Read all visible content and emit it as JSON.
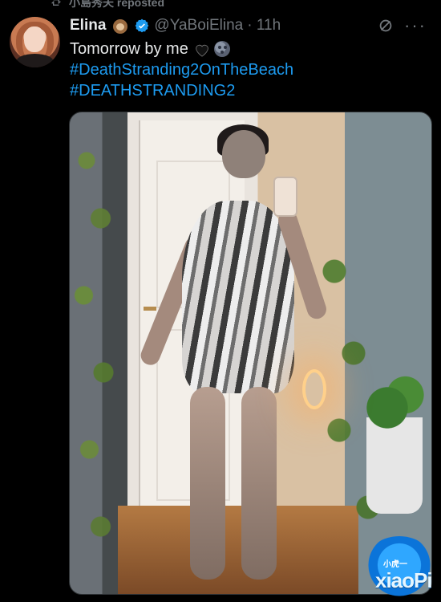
{
  "repost_bar": {
    "text": "小島秀夫 reposted"
  },
  "tweet": {
    "author_name": "Elina",
    "handle": "@YaBoiElina",
    "time": "· 11h",
    "text_line1": "Tomorrow by me",
    "hashtag1": "#DeathStranding2OnTheBeach",
    "hashtag2": "#DEATHSTRANDING2",
    "icons": {
      "author_emoji": "monkey-emoji-icon",
      "verified": "verified-badge-icon",
      "grok": "grok-icon",
      "more": "more-icon",
      "heart": "black-heart-emoji-icon",
      "moon": "moon-emoji-icon"
    }
  },
  "colors": {
    "background": "#000000",
    "text": "#e7e9ea",
    "muted": "#71767b",
    "link": "#1d9bf0",
    "watermark": "#1d8cff"
  },
  "watermark": {
    "small": "小虎一",
    "big": "xiaoPi"
  }
}
